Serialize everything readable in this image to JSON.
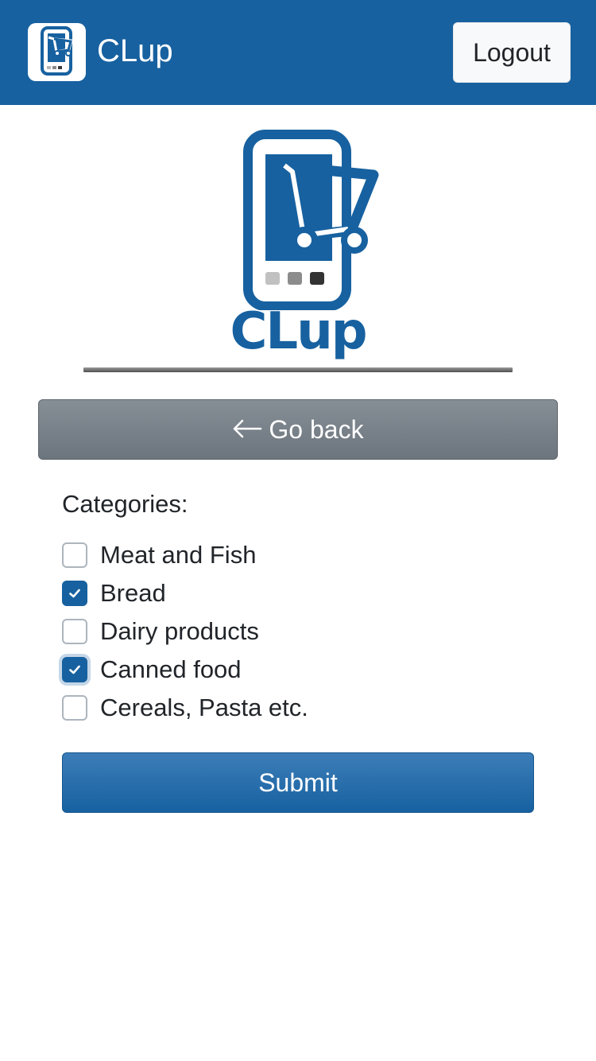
{
  "header": {
    "brand_name": "CLup",
    "logout_label": "Logout"
  },
  "logo": {
    "wordmark": "CLup"
  },
  "actions": {
    "go_back_label": "Go back",
    "submit_label": "Submit"
  },
  "form": {
    "categories_label": "Categories:",
    "categories": [
      {
        "label": "Meat and Fish",
        "checked": false
      },
      {
        "label": "Bread",
        "checked": true
      },
      {
        "label": "Dairy products",
        "checked": false
      },
      {
        "label": "Canned food",
        "checked": true,
        "focused": true
      },
      {
        "label": "Cereals, Pasta etc.",
        "checked": false
      }
    ]
  },
  "icons": {
    "brand": "cart-phone-logo-icon",
    "back": "arrow-left-icon",
    "check": "checkmark-icon"
  },
  "colors": {
    "primary": "#1761a0",
    "secondary": "#6c757d",
    "light_button": "#f8f9fa"
  }
}
